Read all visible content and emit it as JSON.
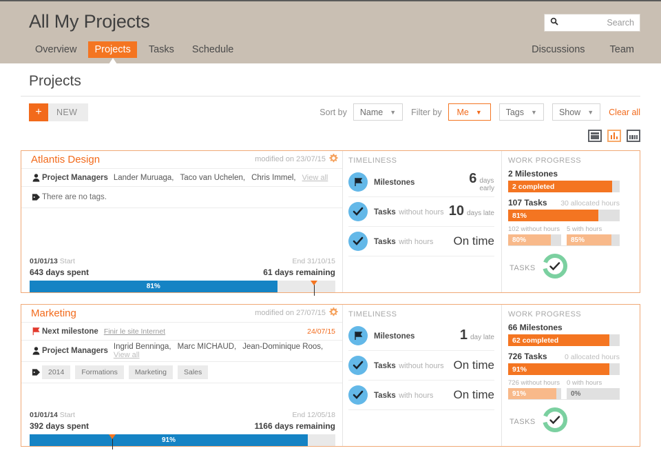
{
  "header": {
    "app_title": "All My Projects",
    "nav": [
      {
        "label": "Overview",
        "active": false
      },
      {
        "label": "Projects",
        "active": true
      },
      {
        "label": "Tasks",
        "active": false
      },
      {
        "label": "Schedule",
        "active": false
      }
    ],
    "nav_right": [
      {
        "label": "Discussions"
      },
      {
        "label": "Team"
      }
    ],
    "search": {
      "placeholder": "Search",
      "value": "",
      "icon": "search-icon"
    },
    "background_color": "#c9bfb3"
  },
  "page": {
    "title": "Projects"
  },
  "toolbar": {
    "new_plus": "+",
    "new_label": "NEW",
    "sort_by_label": "Sort by",
    "sort_by_value": "Name",
    "filter_by_label": "Filter by",
    "filter_me_value": "Me",
    "filter_tags_value": "Tags",
    "filter_show_value": "Show",
    "clear_all_label": "Clear all",
    "caret": "▼",
    "accent_color": "#f26a1b"
  },
  "view_switch": [
    {
      "name": "view-list",
      "active": false
    },
    {
      "name": "view-chart",
      "active": true
    },
    {
      "name": "view-grid",
      "active": false
    }
  ],
  "labels": {
    "timeliness": "TIMELINESS",
    "work_progress": "WORK PROGRESS",
    "tasks": "TASKS",
    "project_managers": "Project Managers",
    "next_milestone": "Next milestone",
    "view_all": "View all",
    "no_tags": "There are no tags.",
    "start": "Start",
    "milestones": "Milestones",
    "tasks_without_hours": "Tasks",
    "tasks_without_hours_sub": "without hours",
    "tasks_with_hours": "Tasks",
    "tasks_with_hours_sub": "with hours"
  },
  "projects": [
    {
      "name": "Atlantis Design",
      "modified": "modified on 23/07/15",
      "has_milestone_row": false,
      "managers": [
        "Lander Muruaga,",
        "Taco van Uchelen,",
        "Chris Immel,"
      ],
      "tags": [],
      "timeliness": [
        {
          "icon": "flag-icon",
          "label": "Milestones",
          "sub": "",
          "value": "6",
          "unit": "days\nearly",
          "ontime": false
        },
        {
          "icon": "check-icon",
          "label": "Tasks",
          "sub": "without hours",
          "value": "10",
          "unit": "days late",
          "ontime": false
        },
        {
          "icon": "check-icon",
          "label": "Tasks",
          "sub": "with hours",
          "value": "On time",
          "unit": "",
          "ontime": true
        }
      ],
      "work_progress": {
        "milestones_title": "2 Milestones",
        "milestones_alloc": "",
        "milestones_bar_text": "2 completed",
        "milestones_bar_pct": 93,
        "tasks_title": "107 Tasks",
        "tasks_alloc": "30 allocated hours",
        "tasks_bar_text": "81%",
        "tasks_bar_pct": 81,
        "sub": [
          {
            "label": "102 without hours",
            "text": "80%",
            "pct": 80,
            "dark_text": false
          },
          {
            "label": "5 with hours",
            "text": "85%",
            "pct": 85,
            "dark_text": false
          }
        ]
      },
      "tasks_gauge": {
        "percent": 100,
        "color": "#7bd0a0",
        "icon": "check-icon"
      },
      "timeline": {
        "start_date": "01/01/13",
        "end_date": "End 31/10/15",
        "days_spent": "643 days spent",
        "days_remaining": "61 days remaining",
        "progress_pct": 81,
        "progress_label": "81%",
        "marker_pct": 93
      }
    },
    {
      "name": "Marketing",
      "modified": "modified on 27/07/15",
      "has_milestone_row": true,
      "milestone_link": "Finir le site Internet",
      "milestone_date": "24/07/15",
      "managers": [
        "Ingrid Benninga,",
        "Marc MICHAUD,",
        "Jean-Dominique Roos,"
      ],
      "tags": [
        "2014",
        "Formations",
        "Marketing",
        "Sales"
      ],
      "timeliness": [
        {
          "icon": "flag-icon",
          "label": "Milestones",
          "sub": "",
          "value": "1",
          "unit": "day late",
          "ontime": false
        },
        {
          "icon": "check-icon",
          "label": "Tasks",
          "sub": "without hours",
          "value": "On time",
          "unit": "",
          "ontime": true
        },
        {
          "icon": "check-icon",
          "label": "Tasks",
          "sub": "with hours",
          "value": "On time",
          "unit": "",
          "ontime": true
        }
      ],
      "work_progress": {
        "milestones_title": "66 Milestones",
        "milestones_alloc": "",
        "milestones_bar_text": "62 completed",
        "milestones_bar_pct": 91,
        "tasks_title": "726 Tasks",
        "tasks_alloc": "0 allocated hours",
        "tasks_bar_text": "91%",
        "tasks_bar_pct": 91,
        "sub": [
          {
            "label": "726 without hours",
            "text": "91%",
            "pct": 91,
            "dark_text": false
          },
          {
            "label": "0 with hours",
            "text": "0%",
            "pct": 0,
            "dark_text": true
          }
        ]
      },
      "tasks_gauge": {
        "percent": 100,
        "color": "#7bd0a0",
        "icon": "check-icon"
      },
      "timeline": {
        "start_date": "01/01/14",
        "end_date": "End 12/05/18",
        "days_spent": "392 days spent",
        "days_remaining": "1166 days remaining",
        "progress_pct": 91,
        "progress_label": "91%",
        "marker_pct": 27
      }
    }
  ]
}
